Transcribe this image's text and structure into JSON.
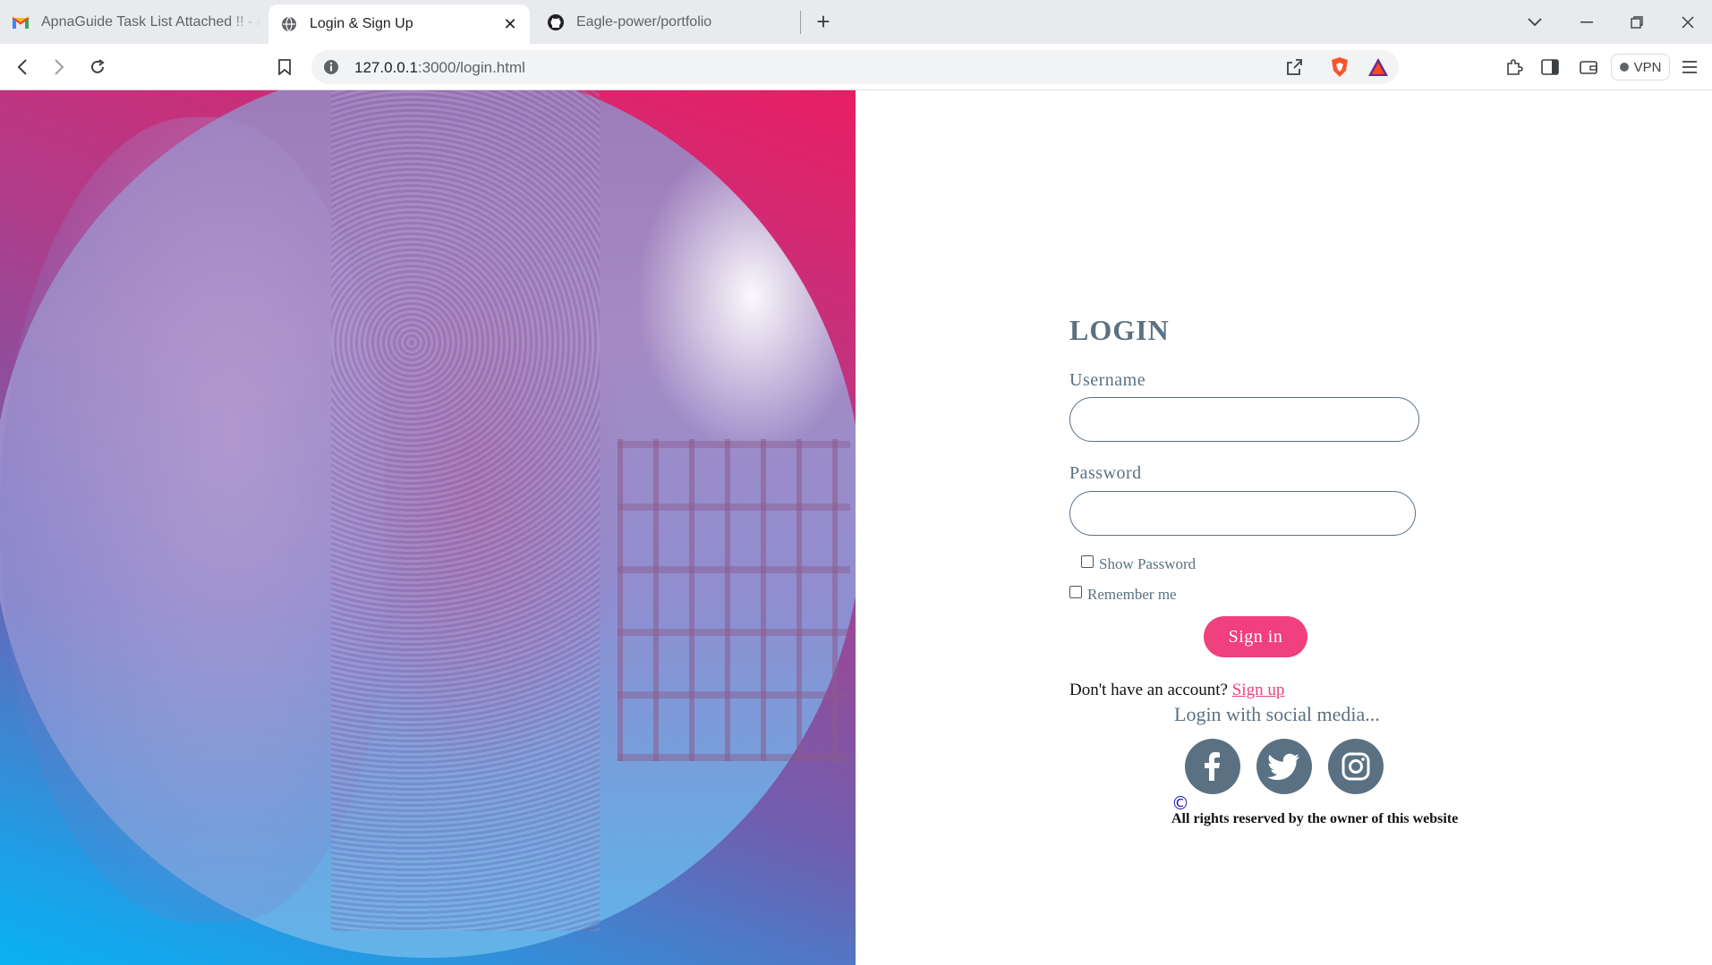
{
  "browser": {
    "tabs": [
      {
        "title": "ApnaGuide Task List Attached !! - an",
        "icon": "gmail-icon",
        "active": false
      },
      {
        "title": "Login & Sign Up",
        "icon": "globe-icon",
        "active": true
      },
      {
        "title": "Eagle-power/portfolio",
        "icon": "github-icon",
        "active": false
      }
    ],
    "new_tab_glyph": "+",
    "close_glyph": "✕",
    "url_host": "127.0.0.1",
    "url_rest": ":3000/login.html",
    "vpn_label": "VPN"
  },
  "login": {
    "title": "LOGIN",
    "username_label": "Username",
    "username_value": "",
    "password_label": "Password",
    "password_value": "",
    "show_password_label": "Show Password",
    "remember_label": "Remember me",
    "signin_label": "Sign in",
    "no_account_text": "Don't have an account?",
    "signup_link": "Sign up"
  },
  "social": {
    "title": "Login with social media...",
    "networks": [
      "facebook-icon",
      "twitter-icon",
      "instagram-icon"
    ]
  },
  "footer": {
    "copyright_symbol": "©",
    "rights_text": "All rights reserved by the owner of this website"
  },
  "colors": {
    "accent": "#f0407e",
    "text_muted": "#5a7184",
    "hero_top": "#e91e63",
    "hero_bottom": "#09b2f2"
  }
}
